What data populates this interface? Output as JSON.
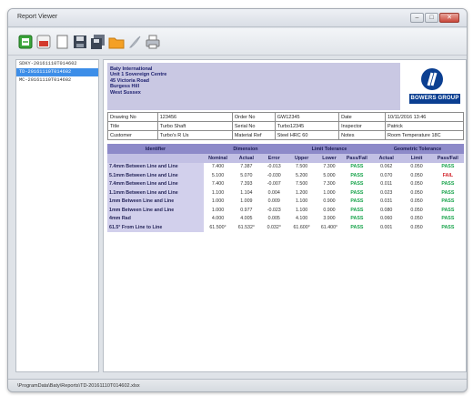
{
  "window": {
    "title": "Report Viewer",
    "controls": [
      "–",
      "□",
      "✕"
    ]
  },
  "toolbar": {
    "buttons": [
      {
        "name": "open-green-button",
        "icon": "open-file-icon"
      },
      {
        "name": "open-pdf-button",
        "icon": "pdf-file-icon"
      },
      {
        "name": "new-blank-button",
        "icon": "blank-page-icon"
      },
      {
        "name": "save-button",
        "icon": "floppy-disk-icon"
      },
      {
        "name": "save-as-button",
        "icon": "floppy-disk-stack-icon"
      },
      {
        "name": "export-button",
        "icon": "orange-folder-icon"
      },
      {
        "name": "email-button",
        "icon": "feather-icon"
      },
      {
        "name": "print-button",
        "icon": "printer-icon"
      }
    ]
  },
  "sidebar": {
    "items": [
      {
        "label": "SDKY-20161110T014602",
        "selected": false
      },
      {
        "label": "TD-20161110T014602",
        "selected": true
      },
      {
        "label": "MC-20161110T014602",
        "selected": false
      }
    ]
  },
  "report": {
    "address": [
      "Baty International",
      "Unit 1 Sovereign Centre",
      "45 Victoria Road",
      "Burgess Hill",
      "West Sussex"
    ],
    "logo_text": "BOWERS GROUP",
    "info_rows": [
      [
        "Drawing No",
        "123456",
        "Order No",
        "GW12345",
        "Date",
        "10/11/2016 13:46"
      ],
      [
        "Title",
        "Turbo Shaft",
        "Serial No",
        "Turbo12345",
        "Inspector",
        "Patrick"
      ],
      [
        "Customer",
        "Turbo's R Us",
        "Material Ref",
        "Steel HRC 60",
        "Notes",
        "Room Temperature 18C"
      ]
    ],
    "results": {
      "groups": {
        "identifier": "Identifier",
        "dimension": "Dimension",
        "limit": "Limit Tolerance",
        "geometric": "Geometric Tolerance"
      },
      "columns": [
        "Nominal",
        "Actual",
        "Error",
        "Upper",
        "Lower",
        "Pass/Fail",
        "Actual",
        "Limit",
        "Pass/Fail"
      ],
      "rows": [
        {
          "id": "7.4mm Between Line and Line",
          "cells": [
            "7.400",
            "7.387",
            "-0.013",
            "7.500",
            "7.300",
            "PASS",
            "0.062",
            "0.050",
            "PASS"
          ]
        },
        {
          "id": "5.1mm Between Line and Line",
          "cells": [
            "5.100",
            "5.070",
            "-0.030",
            "5.200",
            "5.000",
            "PASS",
            "0.070",
            "0.050",
            "FAIL"
          ]
        },
        {
          "id": "7.4mm Between Line and Line",
          "cells": [
            "7.400",
            "7.393",
            "-0.007",
            "7.500",
            "7.300",
            "PASS",
            "0.011",
            "0.050",
            "PASS"
          ]
        },
        {
          "id": "1.1mm Between Line and Line",
          "cells": [
            "1.100",
            "1.104",
            "0.004",
            "1.200",
            "1.000",
            "PASS",
            "0.023",
            "0.050",
            "PASS"
          ]
        },
        {
          "id": "1mm Between Line and Line",
          "cells": [
            "1.000",
            "1.009",
            "0.009",
            "1.100",
            "0.900",
            "PASS",
            "0.031",
            "0.050",
            "PASS"
          ]
        },
        {
          "id": "1mm Between Line and Line",
          "cells": [
            "1.000",
            "0.977",
            "-0.023",
            "1.100",
            "0.900",
            "PASS",
            "0.080",
            "0.050",
            "PASS"
          ]
        },
        {
          "id": "4mm Rad",
          "cells": [
            "4.000",
            "4.005",
            "0.005",
            "4.100",
            "3.900",
            "PASS",
            "0.060",
            "0.050",
            "PASS"
          ]
        },
        {
          "id": "61.5° From Line to Line",
          "cells": [
            "61.500°",
            "61.532°",
            "0.032°",
            "61.600°",
            "61.400°",
            "PASS",
            "0.001",
            "0.050",
            "PASS"
          ]
        }
      ]
    },
    "bottom_field": "TD"
  },
  "statusbar": {
    "path": "\\ProgramData\\Baty\\Reports\\TD-20161110T014602.xlsx"
  }
}
